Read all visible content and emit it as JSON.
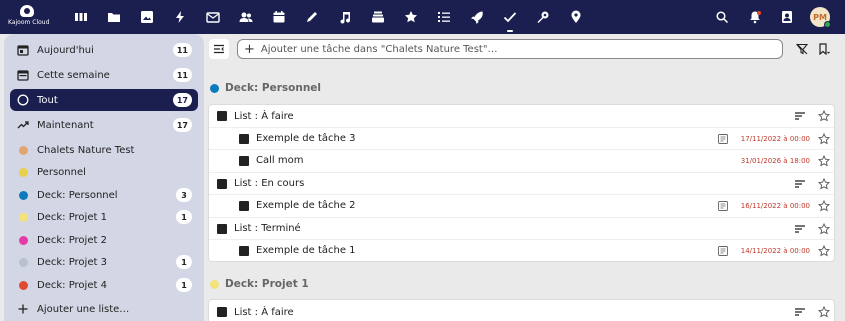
{
  "brand": {
    "name": "Kajoom Cloud"
  },
  "topbar": {
    "apps": [
      {
        "name": "dashboard-icon"
      },
      {
        "name": "files-icon"
      },
      {
        "name": "photos-icon"
      },
      {
        "name": "activity-icon"
      },
      {
        "name": "mail-icon"
      },
      {
        "name": "contacts-icon"
      },
      {
        "name": "calendar-icon"
      },
      {
        "name": "notes-icon"
      },
      {
        "name": "music-icon"
      },
      {
        "name": "deck-icon"
      },
      {
        "name": "favorites-icon"
      },
      {
        "name": "list-icon"
      },
      {
        "name": "rocket-icon"
      },
      {
        "name": "tasks-icon",
        "active": true
      },
      {
        "name": "tools-icon"
      },
      {
        "name": "maps-icon"
      }
    ],
    "right": [
      {
        "name": "search-icon"
      },
      {
        "name": "notifications-icon"
      },
      {
        "name": "contacts-menu-icon"
      }
    ],
    "avatar_initials": "PM"
  },
  "sidebar": {
    "items": [
      {
        "label": "Aujourd'hui",
        "count": "11",
        "icon": "calendar-today-icon"
      },
      {
        "label": "Cette semaine",
        "count": "11",
        "icon": "calendar-week-icon"
      },
      {
        "label": "Tout",
        "count": "17",
        "icon": "circle-outline-icon",
        "active": true
      },
      {
        "label": "Maintenant",
        "count": "17",
        "icon": "trend-icon"
      },
      {
        "label": "Chalets Nature Test",
        "count": "",
        "color": "#e3a56f"
      },
      {
        "label": "Personnel",
        "count": "",
        "color": "#e8d04a"
      },
      {
        "label": "Deck: Personnel",
        "count": "3",
        "color": "#0c7bbd"
      },
      {
        "label": "Deck: Projet 1",
        "count": "1",
        "color": "#f2e27a"
      },
      {
        "label": "Deck: Projet 2",
        "count": "",
        "color": "#e63aa8"
      },
      {
        "label": "Deck: Projet 3",
        "count": "1",
        "color": "#b9c2cc"
      },
      {
        "label": "Deck: Projet 4",
        "count": "1",
        "color": "#e04a2e"
      },
      {
        "label": "Ajouter une liste…",
        "count": "",
        "icon": "plus-icon"
      }
    ]
  },
  "main": {
    "add_task_placeholder": "Ajouter une tâche dans \"Chalets Nature Test\"…",
    "sections": [
      {
        "title": "Deck: Personnel",
        "color": "#0c7bbd",
        "lists": [
          {
            "label": "List : À faire",
            "tasks": [
              {
                "label": "Exemple de tâche 3",
                "due": "17/11/2022 à 00:00",
                "has_note": true
              },
              {
                "label": "Call mom",
                "due": "31/01/2026 à 18:00",
                "has_note": false
              }
            ]
          },
          {
            "label": "List : En cours",
            "tasks": [
              {
                "label": "Exemple de tâche 2",
                "due": "16/11/2022 à 00:00",
                "has_note": true
              }
            ]
          },
          {
            "label": "List : Terminé",
            "tasks": [
              {
                "label": "Exemple de tâche 1",
                "due": "14/11/2022 à 00:00",
                "has_note": true
              }
            ]
          }
        ]
      },
      {
        "title": "Deck: Projet 1",
        "color": "#f2e27a",
        "lists": [
          {
            "label": "List : À faire",
            "tasks": []
          }
        ]
      }
    ]
  },
  "colors": {
    "topbar": "#1b1f4f",
    "sidebar": "#d3d6e4",
    "due": "#c0392b"
  }
}
